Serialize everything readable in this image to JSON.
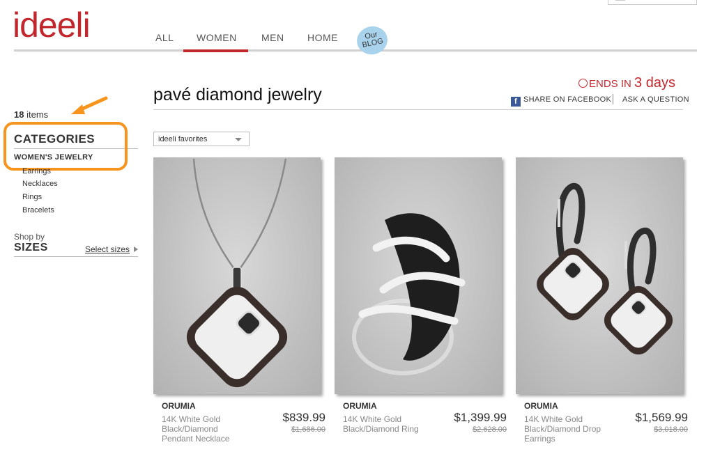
{
  "brand": {
    "logo_text": "ideeli",
    "color": "#c2272d"
  },
  "nav": {
    "items": [
      {
        "label": "ALL",
        "active": false
      },
      {
        "label": "WOMEN",
        "active": true
      },
      {
        "label": "MEN",
        "active": false
      },
      {
        "label": "HOME",
        "active": false
      }
    ],
    "blog_line1": "Our",
    "blog_line2": "BLOG"
  },
  "sidebar": {
    "item_count": "18",
    "item_count_suffix": "items",
    "categories_title": "CATEGORIES",
    "category_active": "WOMEN'S JEWELRY",
    "subcategories": [
      "Earrings",
      "Necklaces",
      "Rings",
      "Bracelets"
    ],
    "shop_by": "Shop by",
    "sizes_title": "SIZES",
    "select_sizes": "Select sizes"
  },
  "sale": {
    "title": "pavé diamond jewelry",
    "ends_prefix": "ENDS IN",
    "ends_value": "3 days",
    "share_label": "SHARE ON FACEBOOK",
    "ask_label": "ASK A QUESTION",
    "sort_value": "ideeli favorites"
  },
  "products": [
    {
      "brand": "ORUMIA",
      "name_lines": [
        "14K White Gold",
        "Black/Diamond",
        "Pendant Necklace"
      ],
      "price": "$839.99",
      "original_price": "$1,686.00",
      "image_icon": "pendant-necklace-image"
    },
    {
      "brand": "ORUMIA",
      "name_lines": [
        "14K White Gold",
        "Black/Diamond Ring"
      ],
      "price": "$1,399.99",
      "original_price": "$2,628.00",
      "image_icon": "ring-image"
    },
    {
      "brand": "ORUMIA",
      "name_lines": [
        "14K White Gold",
        "Black/Diamond Drop",
        "Earrings"
      ],
      "price": "$1,569.99",
      "original_price": "$3,018.00",
      "image_icon": "drop-earrings-image"
    }
  ],
  "colors": {
    "accent": "#c2272d",
    "annotation": "#f7941d",
    "blog_bubble": "#a9d3ec",
    "facebook": "#3b5998"
  }
}
